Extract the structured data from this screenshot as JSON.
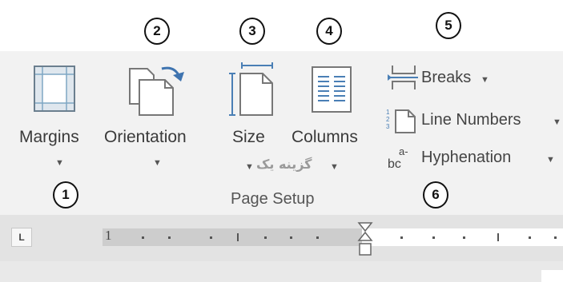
{
  "ribbon": {
    "group_title": "Page Setup",
    "watermark": "گزینه یک",
    "buttons": [
      {
        "id": "margins",
        "label": "Margins",
        "icon": "margins-icon"
      },
      {
        "id": "orientation",
        "label": "Orientation",
        "icon": "orientation-icon"
      },
      {
        "id": "size",
        "label": "Size",
        "icon": "size-icon"
      },
      {
        "id": "columns",
        "label": "Columns",
        "icon": "columns-icon"
      }
    ],
    "small_buttons": [
      {
        "id": "breaks",
        "label": "Breaks",
        "icon": "breaks-icon"
      },
      {
        "id": "line-numbers",
        "label": "Line Numbers",
        "icon": "line-numbers-icon"
      },
      {
        "id": "hyphenation",
        "label": "Hyphenation",
        "icon": "hyphenation-icon"
      }
    ]
  },
  "annotations": [
    "1",
    "2",
    "3",
    "4",
    "5",
    "6"
  ],
  "ruler": {
    "tab_selector": "L",
    "start_number": "1"
  },
  "colors": {
    "ribbon_bg": "#f2f2f2",
    "ruler_bg": "#e3e3e3",
    "icon_blue": "#4a7fb5"
  }
}
